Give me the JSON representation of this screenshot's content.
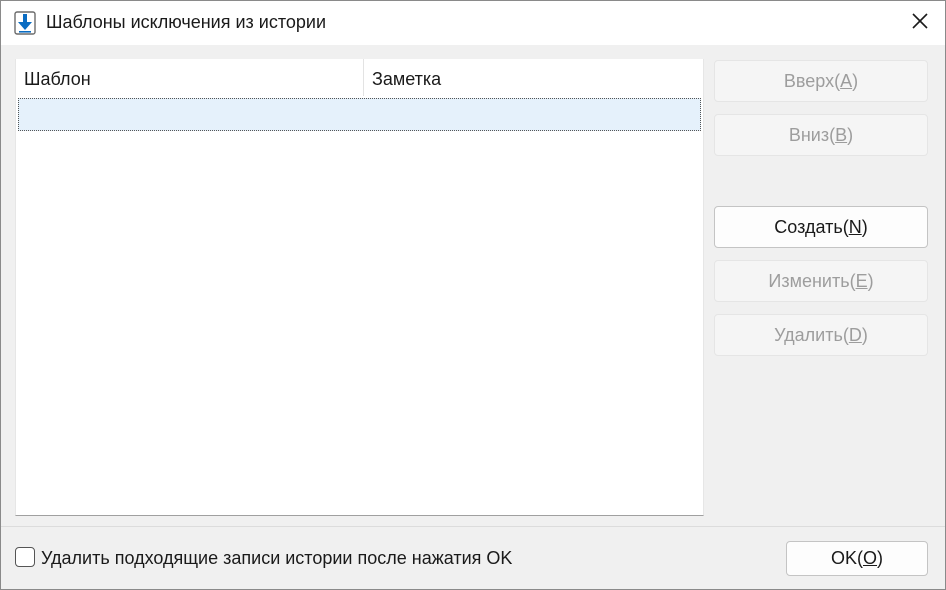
{
  "window": {
    "title": "Шаблоны исключения из истории",
    "app_icon": "download-arrow-icon",
    "close_icon": "close-icon"
  },
  "list": {
    "columns": [
      "Шаблон",
      "Заметка"
    ],
    "rows": [
      {
        "pattern": "",
        "note": ""
      }
    ]
  },
  "buttons": {
    "up": {
      "label": "Вверх(",
      "key": "A",
      "suffix": ")",
      "enabled": false
    },
    "down": {
      "label": "Вниз(",
      "key": "B",
      "suffix": ")",
      "enabled": false
    },
    "create": {
      "label": "Создать(",
      "key": "N",
      "suffix": ")",
      "enabled": true
    },
    "edit": {
      "label": "Изменить(",
      "key": "E",
      "suffix": ")",
      "enabled": false
    },
    "delete": {
      "label": "Удалить(",
      "key": "D",
      "suffix": ")",
      "enabled": false
    },
    "ok": {
      "label": "OK(",
      "key": "O",
      "suffix": ")",
      "enabled": true
    }
  },
  "footer": {
    "checkbox_label": "Удалить подходящие записи истории после нажатия OK",
    "checkbox_checked": false
  },
  "colors": {
    "selection": "#e5f1fb",
    "disabled_text": "#9d9d9d",
    "accent": "#0a6cc2"
  }
}
